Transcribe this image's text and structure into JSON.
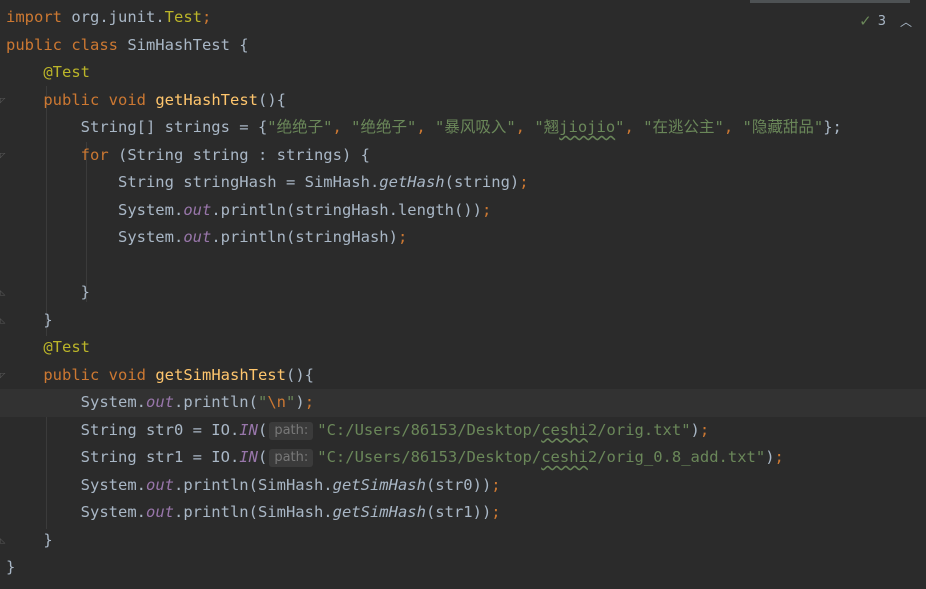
{
  "inspection": {
    "count": "3",
    "check_icon": "double-check-icon",
    "chevron_icon": "chevron-up-icon"
  },
  "code": {
    "l1_kw": "import",
    "l1_pkg": " org.junit.",
    "l1_cls": "Test",
    "l1_semi": ";",
    "l2_kw": "public class",
    "l2_rest": " SimHashTest {",
    "l3_ann": "@Test",
    "l4_kw": "public void",
    "l4_fn": "getHashTest",
    "l4_rest": "(){",
    "l5_a": "String[] strings = {",
    "l5_s1": "\"绝绝子\"",
    "l5_c1": ", ",
    "l5_s2": "\"绝绝子\"",
    "l5_c2": ", ",
    "l5_s3": "\"暴风吸入\"",
    "l5_c3": ", ",
    "l5_s4a": "\"翘",
    "l5_s4b": "jiojio",
    "l5_s4c": "\"",
    "l5_c4": ", ",
    "l5_s5": "\"在逃公主\"",
    "l5_c5": ", ",
    "l5_s6": "\"隐藏甜品\"",
    "l5_end": "};",
    "l6_kw": "for",
    "l6_rest": " (String string : strings) {",
    "l7_a": "String stringHash = SimHash.",
    "l7_m": "getHash",
    "l7_b": "(string)",
    "l7_semi": ";",
    "l8_a": "System.",
    "l8_out": "out",
    "l8_b": ".println(stringHash.length())",
    "l8_semi": ";",
    "l9_a": "System.",
    "l9_out": "out",
    "l9_b": ".println(stringHash)",
    "l9_semi": ";",
    "l11": "}",
    "l12": "}",
    "l13_ann": "@Test",
    "l14_kw": "public void",
    "l14_fn": "getSimHashTest",
    "l14_rest": "(){",
    "l15_a": "System.",
    "l15_out": "out",
    "l15_b": ".println(",
    "l15_q1": "\"",
    "l15_esc": "\\n",
    "l15_q2": "\"",
    "l15_c": ")",
    "l15_semi": ";",
    "l16_a": "String str0 = IO.",
    "l16_in": "IN",
    "l16_p": "(",
    "l16_hint": "path:",
    "l16_s1": "\"C:/Users/86153/Desktop/",
    "l16_s2": "ceshi",
    "l16_s3": "2/orig.txt\"",
    "l16_c": ")",
    "l16_semi": ";",
    "l17_a": "String str1 = IO.",
    "l17_in": "IN",
    "l17_p": "(",
    "l17_hint": "path:",
    "l17_s1": "\"C:/Users/86153/Desktop/",
    "l17_s2": "ceshi",
    "l17_s3": "2/orig_0.8_add.txt\"",
    "l17_c": ")",
    "l17_semi": ";",
    "l18_a": "System.",
    "l18_out": "out",
    "l18_b": ".println(SimHash.",
    "l18_m": "getSimHash",
    "l18_c": "(str0))",
    "l18_semi": ";",
    "l19_a": "System.",
    "l19_out": "out",
    "l19_b": ".println(SimHash.",
    "l19_m": "getSimHash",
    "l19_c": "(str1))",
    "l19_semi": ";",
    "l20": "}",
    "l21": "}"
  },
  "colors": {
    "background": "#2b2b2b",
    "keyword": "#cc7832",
    "annotation": "#bbb529",
    "method_decl": "#ffc66d",
    "string": "#6a8759",
    "static_field": "#9876aa",
    "default_text": "#a9b7c6"
  }
}
